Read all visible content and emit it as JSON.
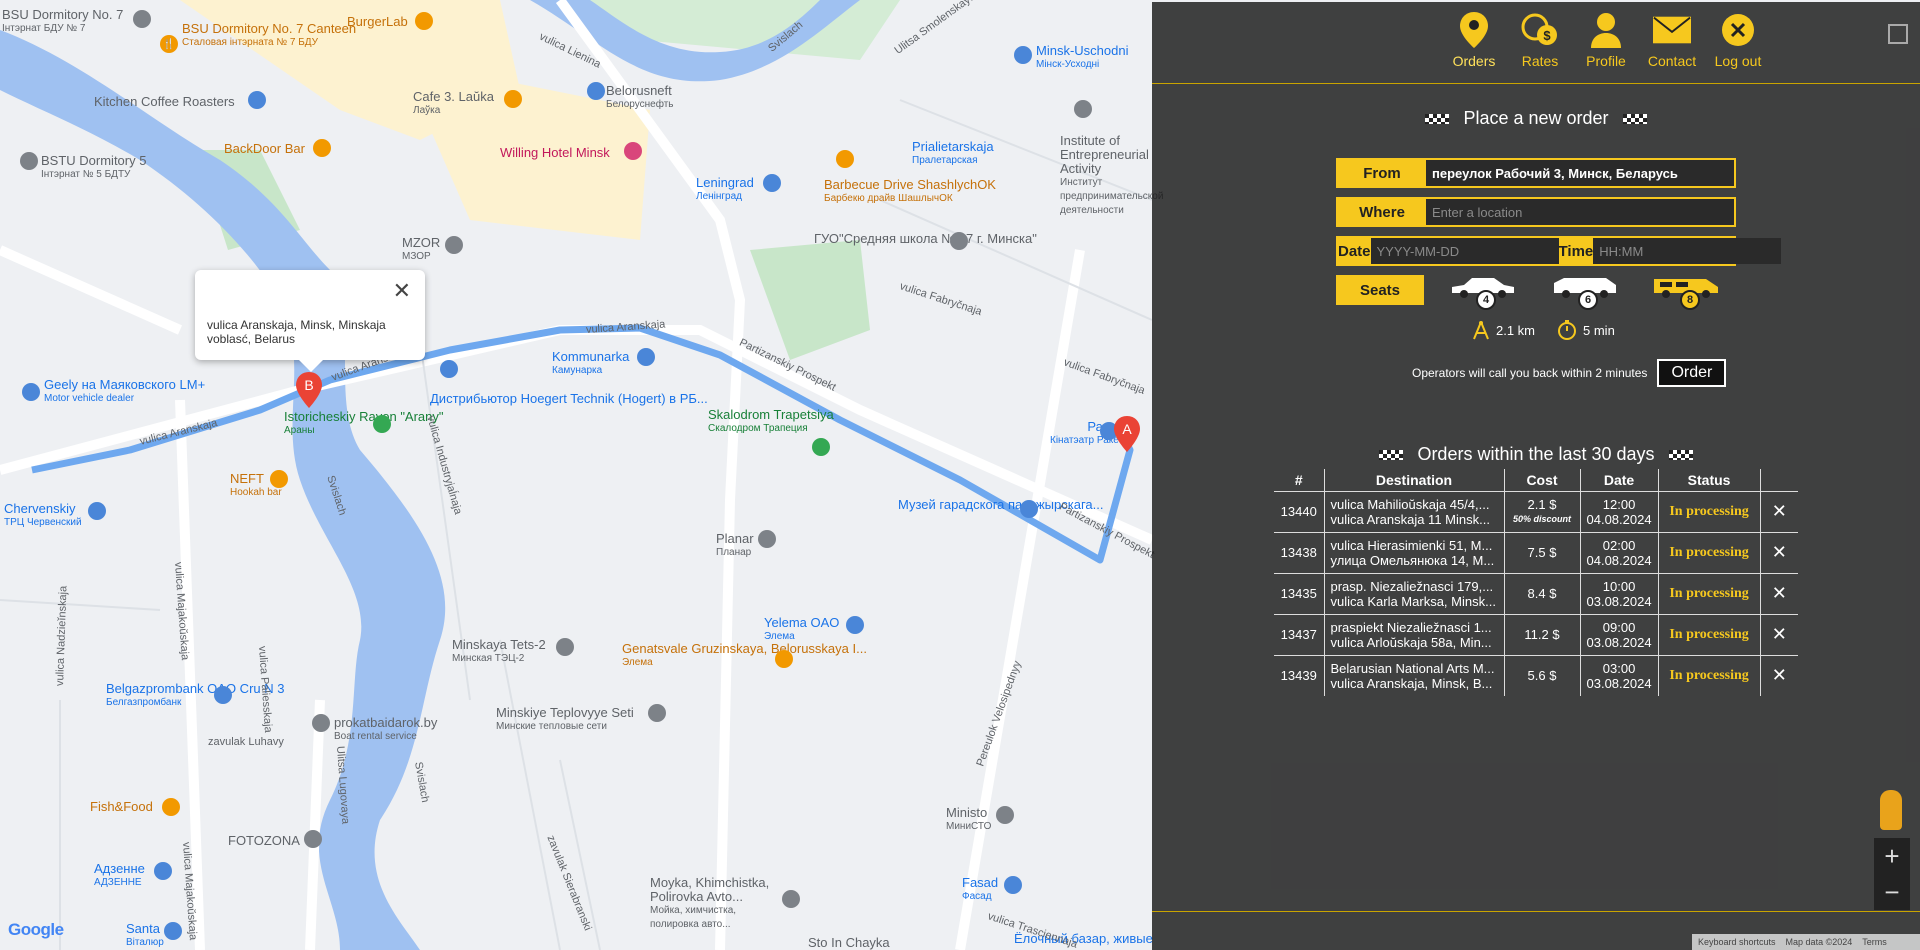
{
  "map": {
    "pois": [
      {
        "name": "BSU Dormitory No. 7",
        "sub": "Інтэрнат БДУ № 7",
        "color": "grey"
      },
      {
        "name": "BSU Dormitory No. 7 Canteen",
        "sub": "Сталовая інтэрната № 7 БДУ",
        "color": "orange"
      },
      {
        "name": "BurgerLab",
        "sub": "",
        "color": "orange"
      },
      {
        "name": "Kitchen Coffee Roasters",
        "sub": "",
        "color": "blue"
      },
      {
        "name": "Cafe 3. Laŭka",
        "sub": "Лаўка",
        "color": "orange"
      },
      {
        "name": "Belorusneft",
        "sub": "Белоруснефть",
        "color": "blue"
      },
      {
        "name": "BSTU Dormitory 5",
        "sub": "Інтэрнат № 5 БДТУ",
        "color": "grey"
      },
      {
        "name": "BackDoor Bar",
        "sub": "",
        "color": "orange"
      },
      {
        "name": "Willing Hotel Minsk",
        "sub": "",
        "color": "pink"
      },
      {
        "name": "MZOR",
        "sub": "МЗОР",
        "color": "grey"
      },
      {
        "name": "Leningrad",
        "sub": "Ленінград",
        "color": "blue"
      },
      {
        "name": "Barbecue Drive ShashlychOK",
        "sub": "Барбекю драйв ШашлычОК",
        "color": "orange"
      },
      {
        "name": "Prialietarskaja",
        "sub": "Пралетарская",
        "color": "blue"
      },
      {
        "name": "Institute of Entrepreneurial Activity",
        "sub": "Институт предпринимательской деятельности",
        "color": "grey"
      },
      {
        "name": "ГУО\"Средняя школа № 47 г. Минска\"",
        "sub": "",
        "color": "grey"
      },
      {
        "name": "Minsk-Uschodni",
        "sub": "Мінск-Усходні",
        "color": "blue"
      },
      {
        "name": "Geely на Маяковского LM+",
        "sub": "Motor vehicle dealer",
        "color": "blue"
      },
      {
        "name": "Kommunarka",
        "sub": "Камунарка",
        "color": "blue"
      },
      {
        "name": "Дистрибьютор Hoegert Technik (Hogert) в РБ...",
        "sub": "",
        "color": "blue"
      },
      {
        "name": "Istoricheskiy Rayon \"Arany\"",
        "sub": "Араны",
        "color": "green"
      },
      {
        "name": "Skalodrom Trapetsiya",
        "sub": "Скалодром Трапеция",
        "color": "green"
      },
      {
        "name": "Ракета",
        "sub": "Кінатэатр Ракета",
        "color": "blue"
      },
      {
        "name": "NEFT",
        "sub": "Hookah bar",
        "color": "orange"
      },
      {
        "name": "Chervenskiy",
        "sub": "ТРЦ Червенский",
        "color": "blue"
      },
      {
        "name": "Музей гарадскога пасажырскага...",
        "sub": "",
        "color": "blue"
      },
      {
        "name": "Planar",
        "sub": "Планар",
        "color": "grey"
      },
      {
        "name": "Yelema OAO",
        "sub": "Элема",
        "color": "blue"
      },
      {
        "name": "Minskaya Tets-2",
        "sub": "Минская ТЭЦ-2",
        "color": "grey"
      },
      {
        "name": "Genatsvale Gruzinskaya, Belorusskaya I...",
        "sub": "Элема",
        "color": "orange"
      },
      {
        "name": "Belgazprombank OAO Cru N 3",
        "sub": "Белгазпромбанк",
        "color": "blue"
      },
      {
        "name": "prokatbaidarok.by",
        "sub": "Boat rental service",
        "color": "grey"
      },
      {
        "name": "Minskiye Teplovyye Seti",
        "sub": "Минские тепловые сети",
        "color": "grey"
      },
      {
        "name": "Fish&Food",
        "sub": "",
        "color": "orange"
      },
      {
        "name": "FOTOZONA",
        "sub": "",
        "color": "grey"
      },
      {
        "name": "Ministo",
        "sub": "МиниСТО",
        "color": "grey"
      },
      {
        "name": "Адзенне",
        "sub": "АДЗЕННЕ",
        "color": "blue"
      },
      {
        "name": "Fasad",
        "sub": "Фасад",
        "color": "blue"
      },
      {
        "name": "Santa",
        "sub": "Віталюр",
        "color": "blue"
      },
      {
        "name": "Moyka, Khimchistka, Polirovka Avto...",
        "sub": "Мойка, химчистка, полировка авто...",
        "color": "grey"
      },
      {
        "name": "Sto In Chayka",
        "sub": "",
        "color": "grey"
      },
      {
        "name": "Ёлочный базар, живые",
        "sub": "",
        "color": "blue"
      }
    ],
    "roads": [
      "vulica Aranskaja",
      "vulica Aranskaja",
      "vulica Aranskaja",
      "Partizanskiy Prospekt",
      "Partizanskiy Prospekt",
      "vulica Lienina",
      "Ulitsa Smolenskaya",
      "Svislach",
      "Svislach",
      "Svislach",
      "vulica Fabryčnaja",
      "vulica Fabryčnaja",
      "vulica Industryjaĺnaja",
      "vulica Majakoŭskaja",
      "vulica Paliesskaja",
      "vulica Nadzieĭnskaja",
      "zavulak Luhavy",
      "Ulitsa Lugovaya",
      "Pereulok Velosipednyy",
      "vulica Majakoŭskaja",
      "zavulak Sierabranski",
      "vulica Trasciennaja"
    ],
    "info_window": {
      "line1": "vulica Aranskaja, Minsk, Minskaja",
      "line2": "voblasć, Belarus"
    },
    "marker_a": "A",
    "marker_b": "B",
    "google": "Google",
    "footer": {
      "shortcuts": "Keyboard shortcuts",
      "data": "Map data ©2024",
      "terms": "Terms"
    }
  },
  "nav": {
    "items": [
      {
        "label": "Orders",
        "icon": "map-pin-icon"
      },
      {
        "label": "Rates",
        "icon": "coins-icon"
      },
      {
        "label": "Profile",
        "icon": "user-icon"
      },
      {
        "label": "Contact",
        "icon": "envelope-icon"
      },
      {
        "label": "Log out",
        "icon": "logout-icon"
      }
    ]
  },
  "order_form": {
    "title": "Place a new order",
    "from_label": "From",
    "from_value": "переулок Рабочий 3, Минск, Беларусь",
    "where_label": "Where",
    "where_placeholder": "Enter a location",
    "date_label": "Date",
    "date_placeholder": "YYYY-MM-DD",
    "time_label": "Time",
    "time_placeholder": "HH:MM",
    "seats_label": "Seats",
    "seat_options": [
      "4",
      "6",
      "8"
    ],
    "selected_seats": "8",
    "distance": "2.1 km",
    "duration": "5 min",
    "callback_note": "Operators will call you back within 2 minutes",
    "order_button": "Order"
  },
  "orders": {
    "title": "Orders within the last 30 days",
    "columns": [
      "#",
      "Destination",
      "Cost",
      "Date",
      "Status"
    ],
    "rows": [
      {
        "id": "13440",
        "from": "vulica Mahilioŭskaja 45/4,...",
        "to": "vulica Aranskaja 11 Minsk...",
        "cost": "2.1 $",
        "discount": "50% discount",
        "time": "12:00",
        "date": "04.08.2024",
        "status": "In processing"
      },
      {
        "id": "13438",
        "from": "vulica Hierasimienki 51, M...",
        "to": "улица Омельянюка 14, М...",
        "cost": "7.5 $",
        "discount": "",
        "time": "02:00",
        "date": "04.08.2024",
        "status": "In processing"
      },
      {
        "id": "13435",
        "from": "prasp. Niezaliežnasci 179,...",
        "to": "vulica Karla Marksa, Minsk...",
        "cost": "8.4 $",
        "discount": "",
        "time": "10:00",
        "date": "03.08.2024",
        "status": "In processing"
      },
      {
        "id": "13437",
        "from": "praspiekt Niezaliežnasci 1...",
        "to": "vulica Arloŭskaja 58a, Min...",
        "cost": "11.2 $",
        "discount": "",
        "time": "09:00",
        "date": "03.08.2024",
        "status": "In processing"
      },
      {
        "id": "13439",
        "from": "Belarusian National Arts M...",
        "to": "vulica Aranskaja, Minsk, B...",
        "cost": "5.6 $",
        "discount": "",
        "time": "03:00",
        "date": "03.08.2024",
        "status": "In processing"
      }
    ]
  },
  "colors": {
    "accent": "#f6c81e",
    "route": "#6ea8ef",
    "overlay": "#181818"
  }
}
